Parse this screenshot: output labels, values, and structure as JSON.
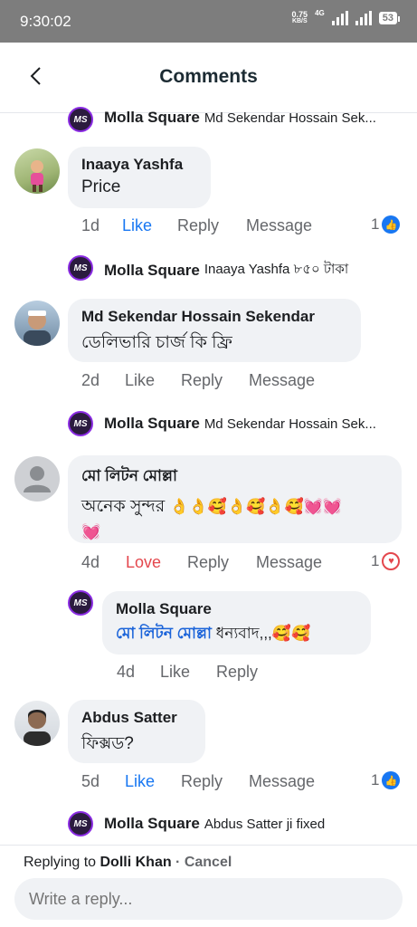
{
  "status": {
    "time": "9:30:02",
    "speed_top": "0.75",
    "speed_bottom": "KB/S",
    "network": "4G",
    "battery": "53"
  },
  "header": {
    "title": "Comments"
  },
  "comments": [
    {
      "reply_name": "Molla Square",
      "reply_text": "Md Sekendar Hossain Sek..."
    },
    {
      "name": "Inaaya Yashfa",
      "text": "Price",
      "time": "1d",
      "like": "Like",
      "reply": "Reply",
      "message": "Message",
      "count": "1",
      "page_reply": {
        "name": "Molla Square",
        "text": "Inaaya Yashfa ৮৫০ টাকা"
      }
    },
    {
      "name": "Md Sekendar Hossain Sekendar",
      "text": "ডেলিভারি চার্জ কি ফ্রি",
      "time": "2d",
      "like": "Like",
      "reply": "Reply",
      "message": "Message",
      "page_reply": {
        "name": "Molla Square",
        "text": "Md Sekendar Hossain Sek..."
      }
    },
    {
      "name": "মো লিটন মোল্লা",
      "text": "অনেক সুন্দর",
      "emojis": "👌👌🥰👌🥰👌🥰💓💓",
      "emojis2": "💓",
      "time": "4d",
      "like": "Love",
      "reply": "Reply",
      "message": "Message",
      "count": "1",
      "page_reply": {
        "name": "Molla Square",
        "mention": "মো লিটন মোল্লা",
        "text": " ধন্যবাদ,,,",
        "emojis": "🥰🥰",
        "time": "4d",
        "like": "Like",
        "reply": "Reply"
      }
    },
    {
      "name": "Abdus Satter",
      "text": "ফিক্সড?",
      "time": "5d",
      "like": "Like",
      "reply": "Reply",
      "message": "Message",
      "count": "1",
      "page_reply": {
        "name": "Molla Square",
        "text": "Abdus Satter ji fixed"
      }
    }
  ],
  "composer": {
    "prefix": "Replying to ",
    "target": "Dolli Khan",
    "separator": " · ",
    "cancel": "Cancel",
    "placeholder": "Write a reply..."
  },
  "colors": {
    "accent": "#1877f2",
    "love": "#e4474d",
    "bubble": "#f0f2f5",
    "statusbar": "#7d7d7d"
  },
  "page_avatar_text": "MS"
}
